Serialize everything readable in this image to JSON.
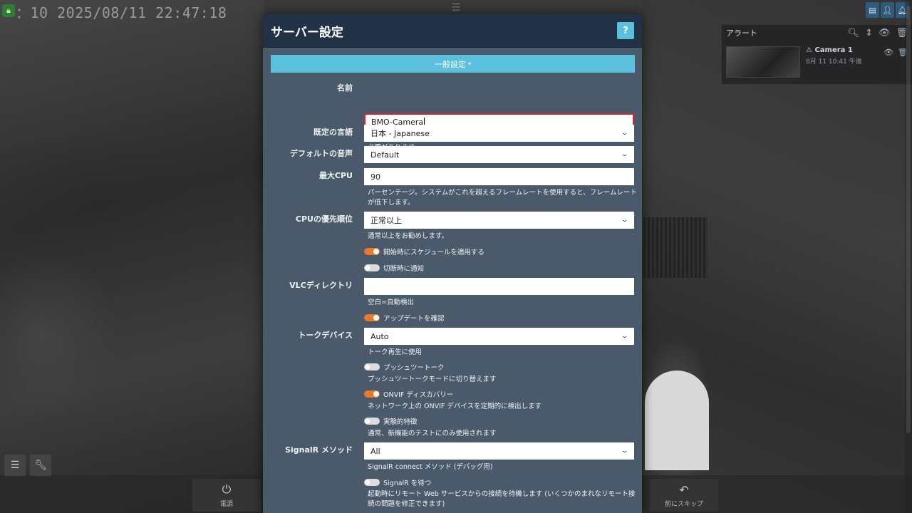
{
  "camera": {
    "timestamp": "：10 2025/08/11 22:47:18"
  },
  "alerts": {
    "title": "アラート",
    "items": [
      {
        "camera": "Camera 1",
        "time": "8月 11 10:41 午後"
      }
    ]
  },
  "bottom": {
    "power_label": "電源",
    "skip_label": "前にスキップ"
  },
  "modal": {
    "title": "サーバー設定",
    "help": "?",
    "section_label": "一般設定",
    "fields": {
      "name": {
        "label": "名前",
        "value": "BMO-Camera",
        "help": "アカウントメニューで権限を設定している場合は、権限の下のグループ設定も変更する必要があります。"
      },
      "language": {
        "label": "既定の言語",
        "value": "日本 - Japanese"
      },
      "audio": {
        "label": "デフォルトの音声",
        "value": "Default"
      },
      "max_cpu": {
        "label": "最大CPU",
        "value": "90",
        "help": "パーセンテージ。システムがこれを超えるフレームレートを使用すると、フレームレートが低下します。"
      },
      "cpu_priority": {
        "label": "CPUの優先順位",
        "value": "正常以上",
        "help": "通常以上をお勧めします。"
      },
      "apply_schedule": {
        "label": "開始時にスケジュールを適用する",
        "on": true
      },
      "notify_disconnect": {
        "label": "切断時に通知",
        "on": false
      },
      "vlc_dir": {
        "label": "VLCディレクトリ",
        "value": "",
        "help": "空白=自動検出"
      },
      "check_updates": {
        "label": "アップデートを確認",
        "on": true
      },
      "talk_device": {
        "label": "トークデバイス",
        "value": "Auto",
        "help": "トーク再生に使用"
      },
      "push_to_talk": {
        "label": "プッシュツートーク",
        "on": false,
        "help": "プッシュツートークモードに切り替えます"
      },
      "onvif": {
        "label": "ONVIF ディスカバリー",
        "on": true,
        "help": "ネットワーク上の ONVIF デバイスを定期的に検出します"
      },
      "experimental": {
        "label": "実験的特徴",
        "on": false,
        "help": "通常、新機能のテストにのみ使用されます"
      },
      "signalr_method": {
        "label": "SignalR メソッド",
        "value": "All",
        "help": "SignalR connect メソッド (デバッグ用)"
      },
      "signalr_wait": {
        "label": "SignalR を待つ",
        "on": false,
        "help": "起動時にリモート Web サービスからの接続を待機します (いくつかのまれなリモート接続の問題を修正できます)"
      }
    }
  },
  "colors": {
    "modal_bg": "#4a5a6a",
    "header_bg": "#213246",
    "accent": "#5bc0de",
    "toggle_on": "#e8782a",
    "focus_border": "#d9262b"
  }
}
